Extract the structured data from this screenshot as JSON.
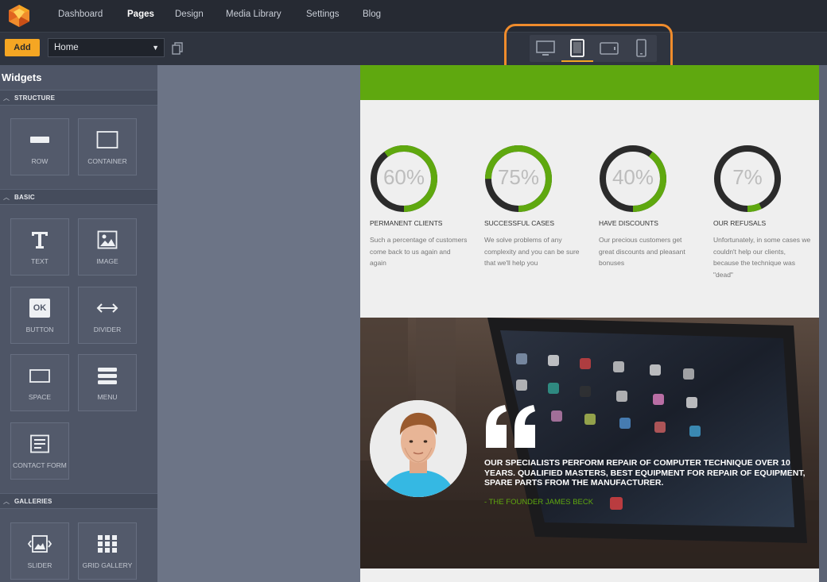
{
  "topnav": {
    "items": [
      "Dashboard",
      "Pages",
      "Design",
      "Media Library",
      "Settings",
      "Blog"
    ],
    "active": "Pages"
  },
  "toolbar": {
    "add_label": "Add",
    "page_select_value": "Home",
    "devices": [
      "desktop-icon",
      "tablet-icon",
      "tablet-landscape-icon",
      "phone-icon"
    ],
    "active_device": "tablet-icon"
  },
  "sidebar": {
    "title": "Widgets",
    "sections": [
      {
        "label": "STRUCTURE",
        "widgets": [
          "ROW",
          "CONTAINER"
        ]
      },
      {
        "label": "BASIC",
        "widgets": [
          "TEXT",
          "IMAGE",
          "BUTTON",
          "DIVIDER",
          "SPACE",
          "MENU",
          "CONTACT FORM"
        ]
      },
      {
        "label": "GALLERIES",
        "widgets": [
          "SLIDER",
          "GRID GALLERY"
        ]
      }
    ],
    "button_icon_text": "OK"
  },
  "page": {
    "stats": [
      {
        "value": 60,
        "label": "60%",
        "title": "PERMANENT CLIENTS",
        "desc": "Such a percentage of customers come back to us again and again"
      },
      {
        "value": 75,
        "label": "75%",
        "title": "SUCCESSFUL CASES",
        "desc": "We solve problems of any complexity and you can be sure that we'll help you"
      },
      {
        "value": 40,
        "label": "40%",
        "title": "HAVE DISCOUNTS",
        "desc": "Our precious customers get great discounts and pleasant bonuses"
      },
      {
        "value": 7,
        "label": "7%",
        "title": "OUR REFUSALS",
        "desc": "Unfortunately, in some cases we couldn't help our clients, because the technique was \"dead\""
      }
    ],
    "quote": {
      "text": "OUR SPECIALISTS PERFORM REPAIR OF COMPUTER TECHNIQUE OVER 10 YEARS. QUALIFIED MASTERS, BEST EQUIPMENT FOR REPAIR OF EQUIPMENT, SPARE PARTS FROM THE MANUFACTURER.",
      "author": "- THE FOUNDER JAMES BECK"
    },
    "colors": {
      "accent": "#5fa80f",
      "highlight": "#f08c2c",
      "add_button": "#f5a623"
    }
  }
}
